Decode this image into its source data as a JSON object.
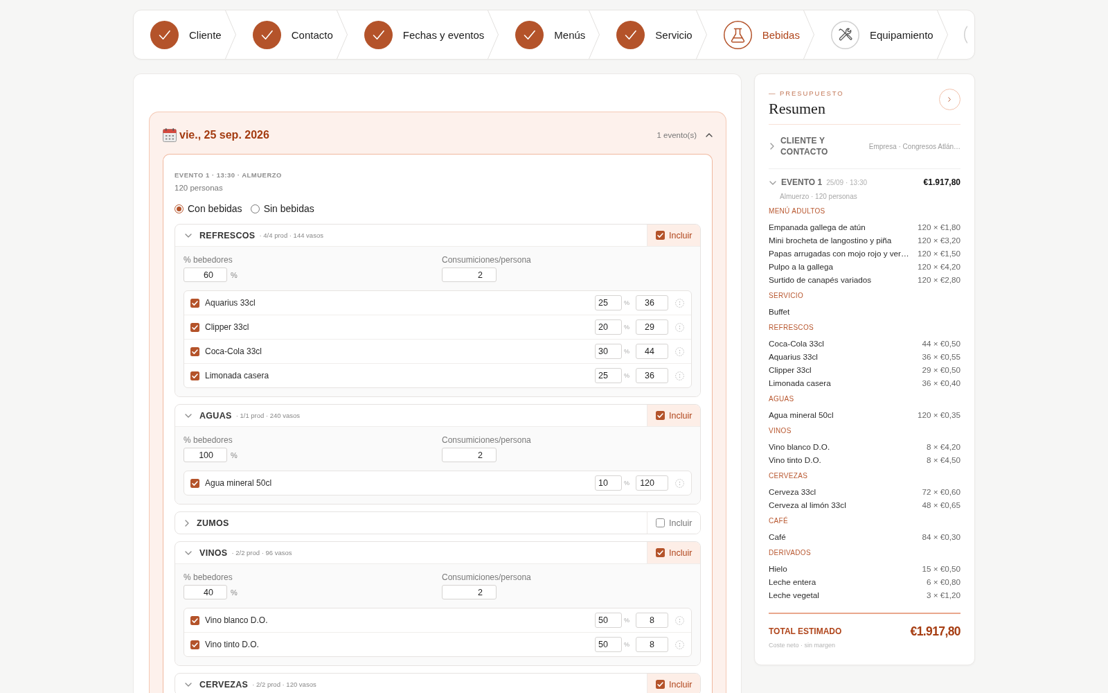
{
  "wizard": {
    "steps": [
      {
        "label": "Cliente",
        "completed": true,
        "selected": false,
        "cut": false
      },
      {
        "label": "Contacto",
        "completed": true,
        "selected": false,
        "cut": false
      },
      {
        "label": "Fechas y eventos",
        "completed": true,
        "selected": false,
        "cut": false
      },
      {
        "label": "Menús",
        "completed": true,
        "selected": false,
        "cut": false
      },
      {
        "label": "Servicio",
        "completed": true,
        "selected": false,
        "cut": false
      },
      {
        "label": "Bebidas",
        "completed": false,
        "selected": true,
        "cut": false
      },
      {
        "label": "Equipamiento",
        "completed": false,
        "selected": false,
        "cut": false
      },
      {
        "completed": false,
        "selected": false,
        "cut": true
      }
    ]
  },
  "drinks_form": {
    "day": {
      "date": "vie., 25 sep. 2026",
      "event_count": "1 evento(s)",
      "expanded": true,
      "events": [
        {
          "heading": "EVENTO 1 · 13:30 · ALMUERZO",
          "guests": "120 personas",
          "drink_options": [
            {
              "label": "Con bebidas",
              "selected": true
            },
            {
              "label": "Sin bebidas",
              "selected": false
            }
          ],
          "categories": [
            {
              "title": "REFRESCOS",
              "meta": "· 4/4 prod · 144 vasos",
              "expanded": true,
              "included": true,
              "include_label": "Incluir",
              "drinkers_label": "% bebedores",
              "drinkers": "60",
              "drinkers_unit": "%",
              "consumption_label": "Consumiciones/persona",
              "consumption": "2",
              "products": [
                {
                  "name": "Aquarius 33cl",
                  "checked": true,
                  "share": "25",
                  "share_unit": "%",
                  "quantity": "36"
                },
                {
                  "name": "Clipper 33cl",
                  "checked": true,
                  "share": "20",
                  "share_unit": "%",
                  "quantity": "29"
                },
                {
                  "name": "Coca-Cola 33cl",
                  "checked": true,
                  "share": "30",
                  "share_unit": "%",
                  "quantity": "44"
                },
                {
                  "name": "Limonada casera",
                  "checked": true,
                  "share": "25",
                  "share_unit": "%",
                  "quantity": "36"
                }
              ]
            },
            {
              "title": "AGUAS",
              "meta": "· 1/1 prod · 240 vasos",
              "expanded": true,
              "included": true,
              "include_label": "Incluir",
              "drinkers_label": "% bebedores",
              "drinkers": "100",
              "drinkers_unit": "%",
              "consumption_label": "Consumiciones/persona",
              "consumption": "2",
              "products": [
                {
                  "name": "Agua mineral 50cl",
                  "checked": true,
                  "share": "10",
                  "share_unit": "%",
                  "quantity": "120"
                }
              ]
            },
            {
              "title": "ZUMOS",
              "expanded": false,
              "included": false,
              "include_label": "Incluir"
            },
            {
              "title": "VINOS",
              "meta": "· 2/2 prod · 96 vasos",
              "expanded": true,
              "included": true,
              "include_label": "Incluir",
              "drinkers_label": "% bebedores",
              "drinkers": "40",
              "drinkers_unit": "%",
              "consumption_label": "Consumiciones/persona",
              "consumption": "2",
              "products": [
                {
                  "name": "Vino blanco D.O.",
                  "checked": true,
                  "share": "50",
                  "share_unit": "%",
                  "quantity": "8"
                },
                {
                  "name": "Vino tinto D.O.",
                  "checked": true,
                  "share": "50",
                  "share_unit": "%",
                  "quantity": "8"
                }
              ]
            },
            {
              "title": "CERVEZAS",
              "meta": "· 2/2 prod · 120 vasos",
              "expanded": true,
              "included": true,
              "include_label": "Incluir"
            }
          ]
        }
      ]
    }
  },
  "summary": {
    "eyebrow": "— PRESUPUESTO",
    "title": "Resumen",
    "client": {
      "label": "CLIENTE Y CONTACTO",
      "value": "Empresa · Congresos Atlán…",
      "expanded": false
    },
    "events": [
      {
        "label": "EVENTO 1",
        "when": "25/09 · 13:30",
        "total": "€1.917,80",
        "detail": "Almuerzo · 120 personas",
        "expanded": true,
        "sections": [
          {
            "title": "MENÚ ADULTOS",
            "lines": [
              {
                "name": "Empanada gallega de atún",
                "amount": "120 × €1,80"
              },
              {
                "name": "Mini brocheta de langostino y piña",
                "amount": "120 × €3,20"
              },
              {
                "name": "Papas arrugadas con mojo rojo y ver…",
                "amount": "120 × €1,50"
              },
              {
                "name": "Pulpo a la gallega",
                "amount": "120 × €4,20"
              },
              {
                "name": "Surtido de canapés variados",
                "amount": "120 × €2,80"
              }
            ]
          },
          {
            "title": "SERVICIO",
            "lines": [
              {
                "name": "Buffet"
              }
            ]
          },
          {
            "title": "REFRESCOS",
            "lines": [
              {
                "name": "Coca-Cola 33cl",
                "amount": "44 × €0,50"
              },
              {
                "name": "Aquarius 33cl",
                "amount": "36 × €0,55"
              },
              {
                "name": "Clipper 33cl",
                "amount": "29 × €0,50"
              },
              {
                "name": "Limonada casera",
                "amount": "36 × €0,40"
              }
            ]
          },
          {
            "title": "AGUAS",
            "lines": [
              {
                "name": "Agua mineral 50cl",
                "amount": "120 × €0,35"
              }
            ]
          },
          {
            "title": "VINOS",
            "lines": [
              {
                "name": "Vino blanco D.O.",
                "amount": "8 × €4,20"
              },
              {
                "name": "Vino tinto D.O.",
                "amount": "8 × €4,50"
              }
            ]
          },
          {
            "title": "CERVEZAS",
            "lines": [
              {
                "name": "Cerveza 33cl",
                "amount": "72 × €0,60"
              },
              {
                "name": "Cerveza al limón 33cl",
                "amount": "48 × €0,65"
              }
            ]
          },
          {
            "title": "CAFÉ",
            "lines": [
              {
                "name": "Café",
                "amount": "84 × €0,30"
              }
            ]
          },
          {
            "title": "DERIVADOS",
            "lines": [
              {
                "name": "Hielo",
                "amount": "15 × €0,50"
              },
              {
                "name": "Leche entera",
                "amount": "6 × €0,80"
              },
              {
                "name": "Leche vegetal",
                "amount": "3 × €1,20"
              }
            ]
          }
        ]
      }
    ],
    "total": {
      "label": "TOTAL ESTIMADO",
      "amount": "€1.917,80",
      "note": "Coste neto · sin margen"
    }
  }
}
